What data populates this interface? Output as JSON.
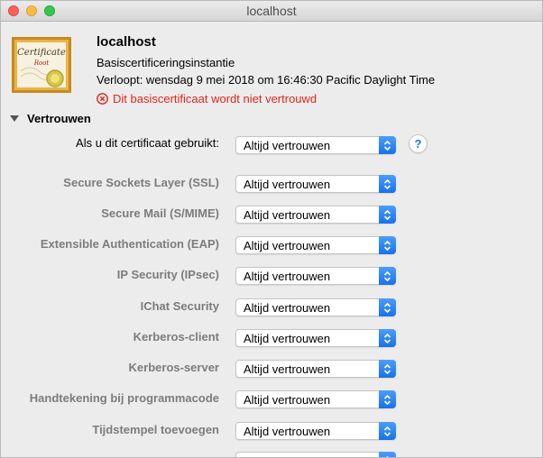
{
  "window": {
    "title": "localhost"
  },
  "certificate": {
    "name": "localhost",
    "kind": "Basiscertificeringsinstantie",
    "expires": "Verloopt: wensdag 9 mei 2018 om 16:46:30 Pacific Daylight Time",
    "warning": "Dit basiscertificaat wordt niet vertrouwd",
    "icon_text_top": "Certificate",
    "icon_text_bottom": "Root",
    "warning_color": "#e1261c"
  },
  "trust": {
    "section_label": "Vertrouwen",
    "main_label": "Als u dit certificaat gebruikt:",
    "main_value": "Altijd vertrouwen",
    "help_label": "?",
    "rows": [
      {
        "label": "Secure Sockets Layer (SSL)",
        "value": "Altijd vertrouwen"
      },
      {
        "label": "Secure Mail (S/MIME)",
        "value": "Altijd vertrouwen"
      },
      {
        "label": "Extensible Authentication (EAP)",
        "value": "Altijd vertrouwen"
      },
      {
        "label": "IP Security (IPsec)",
        "value": "Altijd vertrouwen"
      },
      {
        "label": "IChat Security",
        "value": "Altijd vertrouwen"
      },
      {
        "label": "Kerberos-client",
        "value": "Altijd vertrouwen"
      },
      {
        "label": "Kerberos-server",
        "value": "Altijd vertrouwen"
      },
      {
        "label": "Handtekening bij programmacode",
        "value": "Altijd vertrouwen"
      },
      {
        "label": "Tijdstempel toevoegen",
        "value": "Altijd vertrouwen"
      },
      {
        "label": "",
        "value": ""
      }
    ]
  },
  "colors": {
    "accent": "#1871ed",
    "disabled_label": "#7c7c7c"
  }
}
